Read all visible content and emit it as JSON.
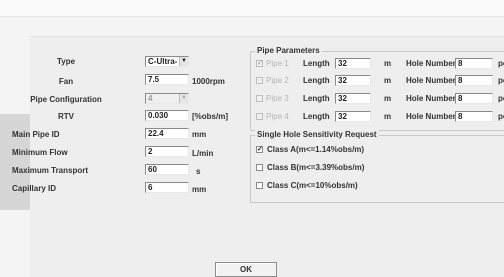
{
  "left": {
    "type": {
      "label": "Type",
      "value": "C-Ultra-"
    },
    "fan": {
      "label": "Fan",
      "value": "7.5",
      "unit": "1000rpm"
    },
    "pipe_config": {
      "label": "Pipe Configuration",
      "value": "4"
    },
    "rtv": {
      "label": "RTV",
      "value": "0.030",
      "unit": "[%obs/m]"
    },
    "main_pipe_id": {
      "label": "Main Pipe ID",
      "value": "22.4",
      "unit": "mm"
    },
    "minimum_flow": {
      "label": "Minimum Flow",
      "value": "2",
      "unit": "L/min"
    },
    "maximum_transport": {
      "label": "Maximum Transport",
      "value": "60",
      "unit": "s"
    },
    "capillary_id": {
      "label": "Capillary ID",
      "value": "6",
      "unit": "mm"
    }
  },
  "pipe_params": {
    "title": "Pipe Parameters",
    "length_label": "Length",
    "length_unit": "m",
    "hole_label": "Hole Number",
    "hole_unit": "pc",
    "pipes": [
      {
        "name": "Pipe 1",
        "length": "32",
        "holes": "8",
        "checked": true
      },
      {
        "name": "Pipe 2",
        "length": "32",
        "holes": "8",
        "checked": false
      },
      {
        "name": "Pipe 3",
        "length": "32",
        "holes": "8",
        "checked": false
      },
      {
        "name": "Pipe 4",
        "length": "32",
        "holes": "8",
        "checked": false
      }
    ]
  },
  "sensitivity": {
    "title": "Single Hole Sensitivity Request",
    "options": [
      {
        "label": "Class A(m<=1.14%obs/m)",
        "checked": true
      },
      {
        "label": "Class B(m<=3.39%obs/m)",
        "checked": false
      },
      {
        "label": "Class C(m<=10%obs/m)",
        "checked": false
      }
    ]
  },
  "ok_label": "OK"
}
